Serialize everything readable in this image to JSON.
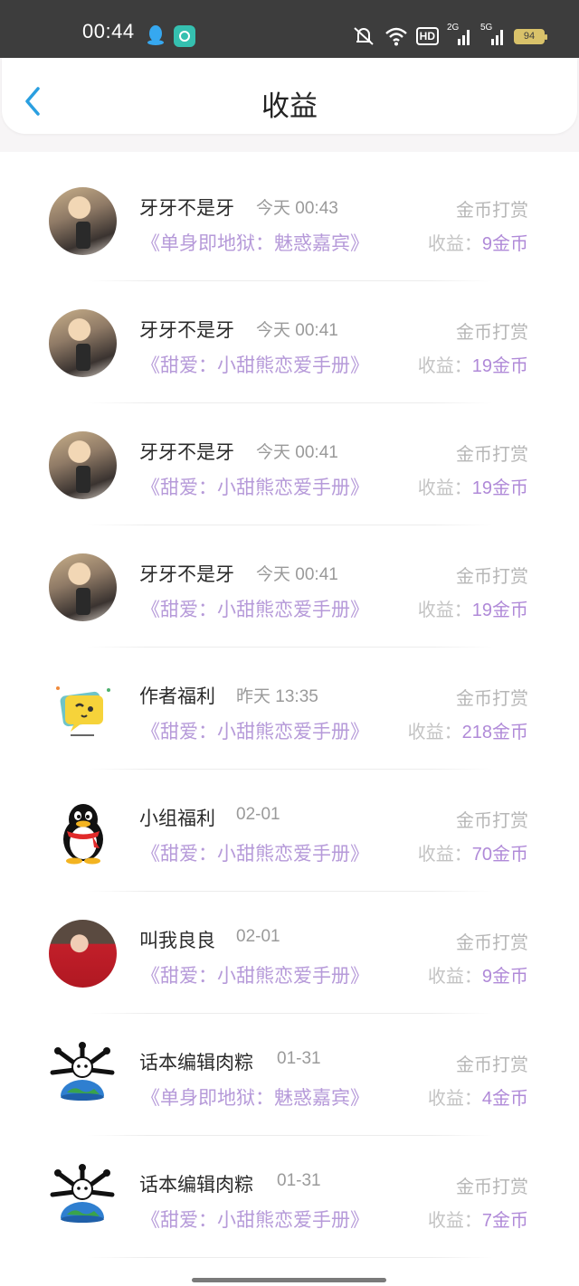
{
  "status_bar": {
    "time": "00:44",
    "network_badge": "HD",
    "signal_1": "2G",
    "signal_2": "5G",
    "battery": "94",
    "icons": [
      "qq-icon",
      "app-notification-icon",
      "mute-icon",
      "wifi-icon",
      "hd-icon",
      "signal-icon",
      "signal-icon",
      "battery-icon"
    ]
  },
  "header": {
    "title": "收益",
    "back_icon": "chevron-left-icon",
    "accent_color": "#2a9fe0"
  },
  "colors": {
    "book_title": "#b69ad9",
    "income_value": "#b08ad8",
    "muted_text": "#b7b7b7"
  },
  "records": [
    {
      "avatar": "user-photo-avatar",
      "name": "牙牙不是牙",
      "time": "今天 00:43",
      "type": "金币打赏",
      "book": "《单身即地狱：魅惑嘉宾》",
      "income_label": "收益：",
      "income_value": "9金币"
    },
    {
      "avatar": "user-photo-avatar",
      "name": "牙牙不是牙",
      "time": "今天 00:41",
      "type": "金币打赏",
      "book": "《甜爱：小甜熊恋爱手册》",
      "income_label": "收益：",
      "income_value": "19金币"
    },
    {
      "avatar": "user-photo-avatar",
      "name": "牙牙不是牙",
      "time": "今天 00:41",
      "type": "金币打赏",
      "book": "《甜爱：小甜熊恋爱手册》",
      "income_label": "收益：",
      "income_value": "19金币"
    },
    {
      "avatar": "user-photo-avatar",
      "name": "牙牙不是牙",
      "time": "今天 00:41",
      "type": "金币打赏",
      "book": "《甜爱：小甜熊恋爱手册》",
      "income_label": "收益：",
      "income_value": "19金币"
    },
    {
      "avatar": "chat-bubble-avatar",
      "name": "作者福利",
      "time": "昨天 13:35",
      "type": "金币打赏",
      "book": "《甜爱：小甜熊恋爱手册》",
      "income_label": "收益：",
      "income_value": "218金币"
    },
    {
      "avatar": "penguin-avatar",
      "name": "小组福利",
      "time": "02-01",
      "type": "金币打赏",
      "book": "《甜爱：小甜熊恋爱手册》",
      "income_label": "收益：",
      "income_value": "70金币"
    },
    {
      "avatar": "user-photo-avatar",
      "name": "叫我良良",
      "time": "02-01",
      "type": "金币打赏",
      "book": "《甜爱：小甜熊恋爱手册》",
      "income_label": "收益：",
      "income_value": "9金币"
    },
    {
      "avatar": "globe-character-avatar",
      "name": "话本编辑肉粽",
      "time": "01-31",
      "type": "金币打赏",
      "book": "《单身即地狱：魅惑嘉宾》",
      "income_label": "收益：",
      "income_value": "4金币"
    },
    {
      "avatar": "globe-character-avatar",
      "name": "话本编辑肉粽",
      "time": "01-31",
      "type": "金币打赏",
      "book": "《甜爱：小甜熊恋爱手册》",
      "income_label": "收益：",
      "income_value": "7金币"
    }
  ]
}
